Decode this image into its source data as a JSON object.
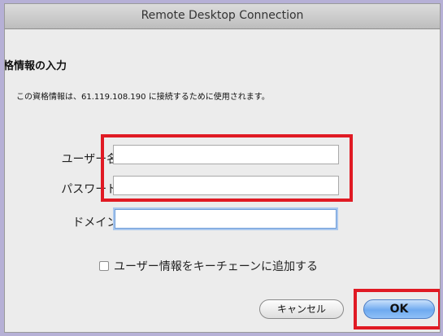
{
  "window": {
    "title": "Remote Desktop Connection"
  },
  "dialog": {
    "heading": "格情報の入力",
    "description": "この資格情報は、61.119.108.190 に接続するために使用されます。",
    "fields": [
      {
        "label": "ユーザー名:",
        "value": ""
      },
      {
        "label": "パスワード:",
        "value": ""
      },
      {
        "label": "ドメイン:",
        "value": ""
      }
    ],
    "keychain_checkbox": {
      "label": "ユーザー情報をキーチェーンに追加する",
      "checked": false
    }
  },
  "buttons": {
    "cancel": "キャンセル",
    "ok": "OK"
  },
  "colors": {
    "highlight": "#e01a24",
    "background": "#b6b0d6",
    "default_button": "#6faaf0"
  }
}
